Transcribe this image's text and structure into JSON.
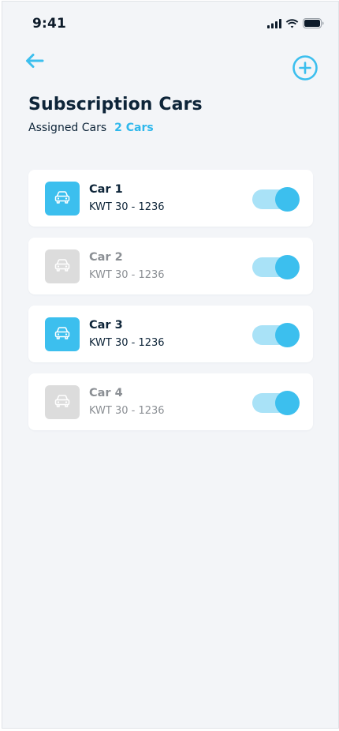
{
  "status_bar": {
    "time": "9:41",
    "icons": [
      "signal-icon",
      "wifi-icon",
      "battery-icon"
    ]
  },
  "header": {
    "back_icon": "arrow-left-icon",
    "add_icon": "plus-circle-icon",
    "title": "Subscription Cars",
    "assigned_label": "Assigned Cars",
    "assigned_count": "2 Cars"
  },
  "colors": {
    "accent": "#3cbfee",
    "accent_light": "#a9e2f7",
    "title": "#0d2438",
    "inactive_icon_bg": "#dcdcdc",
    "inactive_text": "#8b8f94",
    "background": "#f3f5f8"
  },
  "cars": [
    {
      "name": "Car 1",
      "plate": "KWT  30 - 1236",
      "assigned": true,
      "toggle_on": true,
      "icon": "car-icon"
    },
    {
      "name": "Car 2",
      "plate": "KWT  30 - 1236",
      "assigned": false,
      "toggle_on": true,
      "icon": "car-icon"
    },
    {
      "name": "Car 3",
      "plate": "KWT  30 - 1236",
      "assigned": true,
      "toggle_on": true,
      "icon": "car-icon"
    },
    {
      "name": "Car 4",
      "plate": "KWT  30 - 1236",
      "assigned": false,
      "toggle_on": true,
      "icon": "car-icon"
    }
  ]
}
